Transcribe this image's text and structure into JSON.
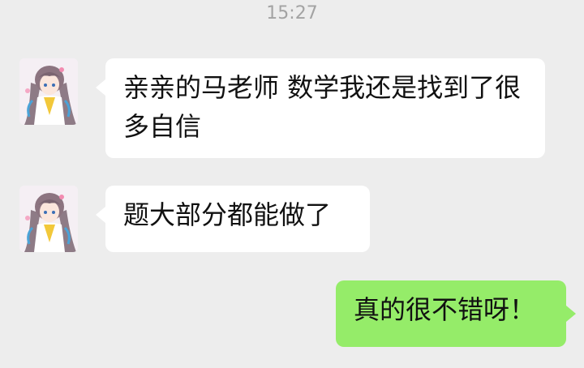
{
  "time": "15:27",
  "messages": [
    {
      "side": "received",
      "avatar_icon": "anime-girl-avatar-icon",
      "text": "亲亲的马老师 数学我还是找到了很多自信"
    },
    {
      "side": "received",
      "avatar_icon": "anime-girl-avatar-icon",
      "text": "题大部分都能做了"
    },
    {
      "side": "sent",
      "text": "真的很不错呀！"
    }
  ],
  "colors": {
    "background": "#ededed",
    "received_bubble": "#ffffff",
    "sent_bubble": "#95ec69",
    "timestamp": "#a3a3a3"
  }
}
